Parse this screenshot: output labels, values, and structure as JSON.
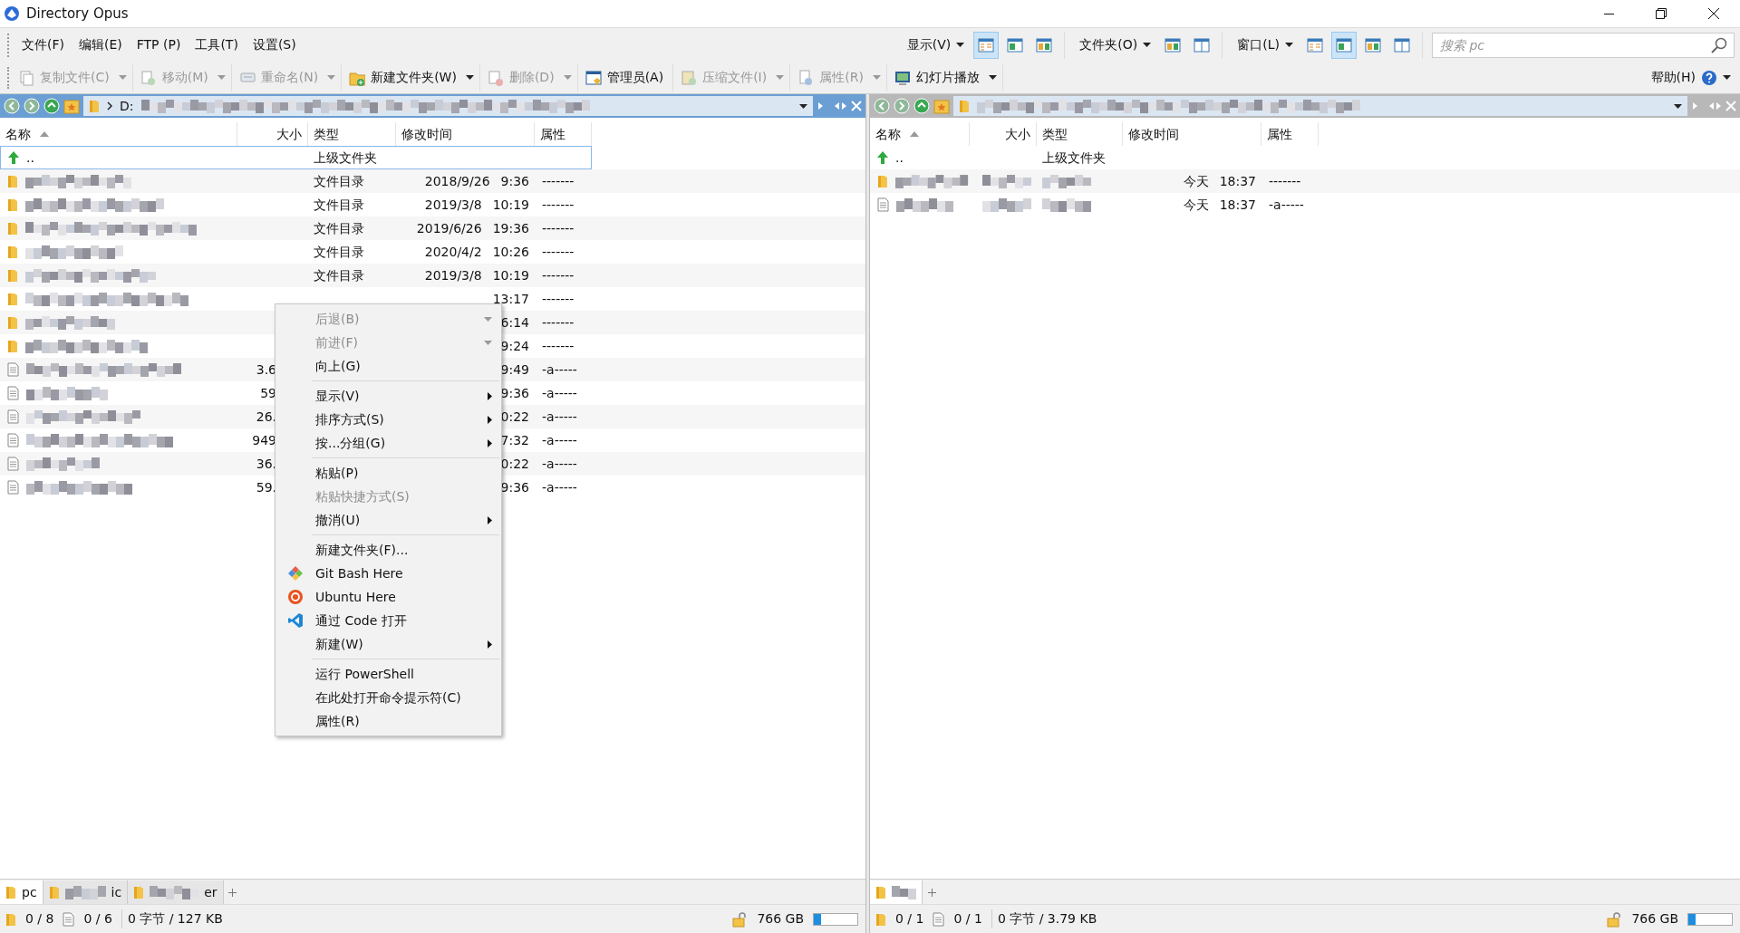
{
  "window": {
    "title": "Directory Opus"
  },
  "menu_bar": [
    "文件(F)",
    "编辑(E)",
    "FTP (P)",
    "工具(T)",
    "设置(S)"
  ],
  "view_groups": [
    {
      "label": "显示(V)",
      "buttons": [
        {
          "selected": true
        },
        {
          "selected": false
        },
        {
          "selected": false
        }
      ]
    },
    {
      "label": "文件夹(O)",
      "buttons": [
        {
          "selected": false
        },
        {
          "selected": false
        }
      ]
    },
    {
      "label": "窗口(L)",
      "buttons": [
        {
          "selected": false
        },
        {
          "selected": true
        },
        {
          "selected": false
        },
        {
          "selected": false
        }
      ]
    }
  ],
  "search": {
    "placeholder": "搜索 pc"
  },
  "toolbar": [
    {
      "label": "复制文件(C)",
      "disabled": true,
      "dropdown": true
    },
    {
      "label": "移动(M)",
      "disabled": true,
      "dropdown": true
    },
    {
      "label": "重命名(N)",
      "disabled": true,
      "dropdown": true
    },
    {
      "label": "新建文件夹(W)",
      "disabled": false,
      "dropdown": true
    },
    {
      "label": "删除(D)",
      "disabled": true,
      "dropdown": true
    },
    {
      "label": "管理员(A)",
      "disabled": false,
      "dropdown": false
    },
    {
      "label": "压缩文件(I)",
      "disabled": true,
      "dropdown": true
    },
    {
      "label": "属性(R)",
      "disabled": true,
      "dropdown": true
    },
    {
      "label": "幻灯片播放",
      "disabled": false,
      "dropdown": true
    }
  ],
  "help": {
    "label": "帮助(H)"
  },
  "left_pane": {
    "path": "D:",
    "active": true,
    "columns": [
      "名称",
      "大小",
      "类型",
      "修改时间",
      "属性"
    ],
    "rows": [
      {
        "kind": "parent",
        "name": "..",
        "type": "上级文件夹",
        "focused": true
      },
      {
        "kind": "folder",
        "type": "文件目录",
        "date": "2018/9/26",
        "time": "9:36",
        "attr": "-------",
        "focused": false
      },
      {
        "kind": "folder",
        "type": "文件目录",
        "date": "2019/3/8",
        "time": "10:19",
        "attr": "-------",
        "focused": false
      },
      {
        "kind": "folder",
        "type": "文件目录",
        "date": "2019/6/26",
        "time": "19:36",
        "attr": "-------",
        "focused": false
      },
      {
        "kind": "folder",
        "type": "文件目录",
        "date": "2020/4/2",
        "time": "10:26",
        "attr": "-------",
        "focused": false
      },
      {
        "kind": "folder",
        "type": "文件目录",
        "date": "2019/3/8",
        "time": "10:19",
        "attr": "-------",
        "focused": false
      },
      {
        "kind": "folder",
        "time": "13:17",
        "attr": "-------",
        "focused": false
      },
      {
        "kind": "folder",
        "time": "6:14",
        "attr": "-------",
        "focused": false
      },
      {
        "kind": "folder",
        "time": "9:24",
        "attr": "-------",
        "focused": false
      },
      {
        "kind": "file",
        "size": "3.6",
        "time": "9:49",
        "attr": "-a-----",
        "focused": false
      },
      {
        "kind": "file",
        "size": "59",
        "time": "9:36",
        "attr": "-a-----",
        "focused": false
      },
      {
        "kind": "file",
        "size": "26.",
        "time": "0:22",
        "attr": "-a-----",
        "focused": false
      },
      {
        "kind": "file",
        "size": "949",
        "time": "7:32",
        "attr": "-a-----",
        "focused": false
      },
      {
        "kind": "file",
        "size": "36.",
        "time": "0:22",
        "attr": "-a-----",
        "focused": false
      },
      {
        "kind": "file",
        "size": "59.",
        "time": "9:36",
        "attr": "-a-----",
        "focused": false
      }
    ],
    "tabs": [
      {
        "label": "pc",
        "selected": true
      },
      {
        "label": "ic",
        "selected": false
      },
      {
        "label": "er",
        "selected": false
      }
    ],
    "status": {
      "folders": "0 / 8",
      "files": "0 / 6",
      "bytes": "0 字节 / 127 KB",
      "free": "766 GB",
      "level": 0.17
    }
  },
  "right_pane": {
    "active": false,
    "columns": [
      "名称",
      "大小",
      "类型",
      "修改时间",
      "属性"
    ],
    "rows": [
      {
        "kind": "parent",
        "name": "..",
        "type": "上级文件夹",
        "focused": false
      },
      {
        "kind": "folder",
        "date": "今天",
        "time": "18:37",
        "attr": "-------",
        "focused": false
      },
      {
        "kind": "file",
        "date": "今天",
        "time": "18:37",
        "attr": "-a-----",
        "focused": false
      }
    ],
    "tabs": [
      {
        "selected": true
      }
    ],
    "status": {
      "folders": "0 / 1",
      "files": "0 / 1",
      "bytes": "0 字节 / 3.79 KB",
      "free": "766 GB",
      "level": 0.17
    }
  },
  "context_menu": [
    {
      "kind": "item",
      "label": "后退(B)",
      "disabled": true,
      "dropdown": true
    },
    {
      "kind": "item",
      "label": "前进(F)",
      "disabled": true,
      "dropdown": true
    },
    {
      "kind": "item",
      "label": "向上(G)",
      "disabled": false
    },
    {
      "kind": "separator"
    },
    {
      "kind": "item",
      "label": "显示(V)",
      "disabled": false,
      "submenu": true
    },
    {
      "kind": "item",
      "label": "排序方式(S)",
      "disabled": false,
      "submenu": true
    },
    {
      "kind": "item",
      "label": "按...分组(G)",
      "disabled": false,
      "submenu": true
    },
    {
      "kind": "separator"
    },
    {
      "kind": "item",
      "label": "粘贴(P)",
      "disabled": false
    },
    {
      "kind": "item",
      "label": "粘贴快捷方式(S)",
      "disabled": true
    },
    {
      "kind": "item",
      "label": "撤消(U)",
      "disabled": false,
      "submenu": true
    },
    {
      "kind": "separator"
    },
    {
      "kind": "item",
      "label": "新建文件夹(F)...",
      "disabled": false
    },
    {
      "kind": "launcher",
      "label": "Git Bash Here",
      "disabled": false
    },
    {
      "kind": "launcher",
      "label": "Ubuntu Here",
      "disabled": false
    },
    {
      "kind": "launcher",
      "label": "通过 Code 打开",
      "disabled": false
    },
    {
      "kind": "item",
      "label": "新建(W)",
      "disabled": false,
      "submenu": true
    },
    {
      "kind": "separator"
    },
    {
      "kind": "item",
      "label": "运行 PowerShell",
      "disabled": false
    },
    {
      "kind": "item",
      "label": "在此处打开命令提示符(C)",
      "disabled": false
    },
    {
      "kind": "item",
      "label": "属性(R)",
      "disabled": false
    }
  ]
}
